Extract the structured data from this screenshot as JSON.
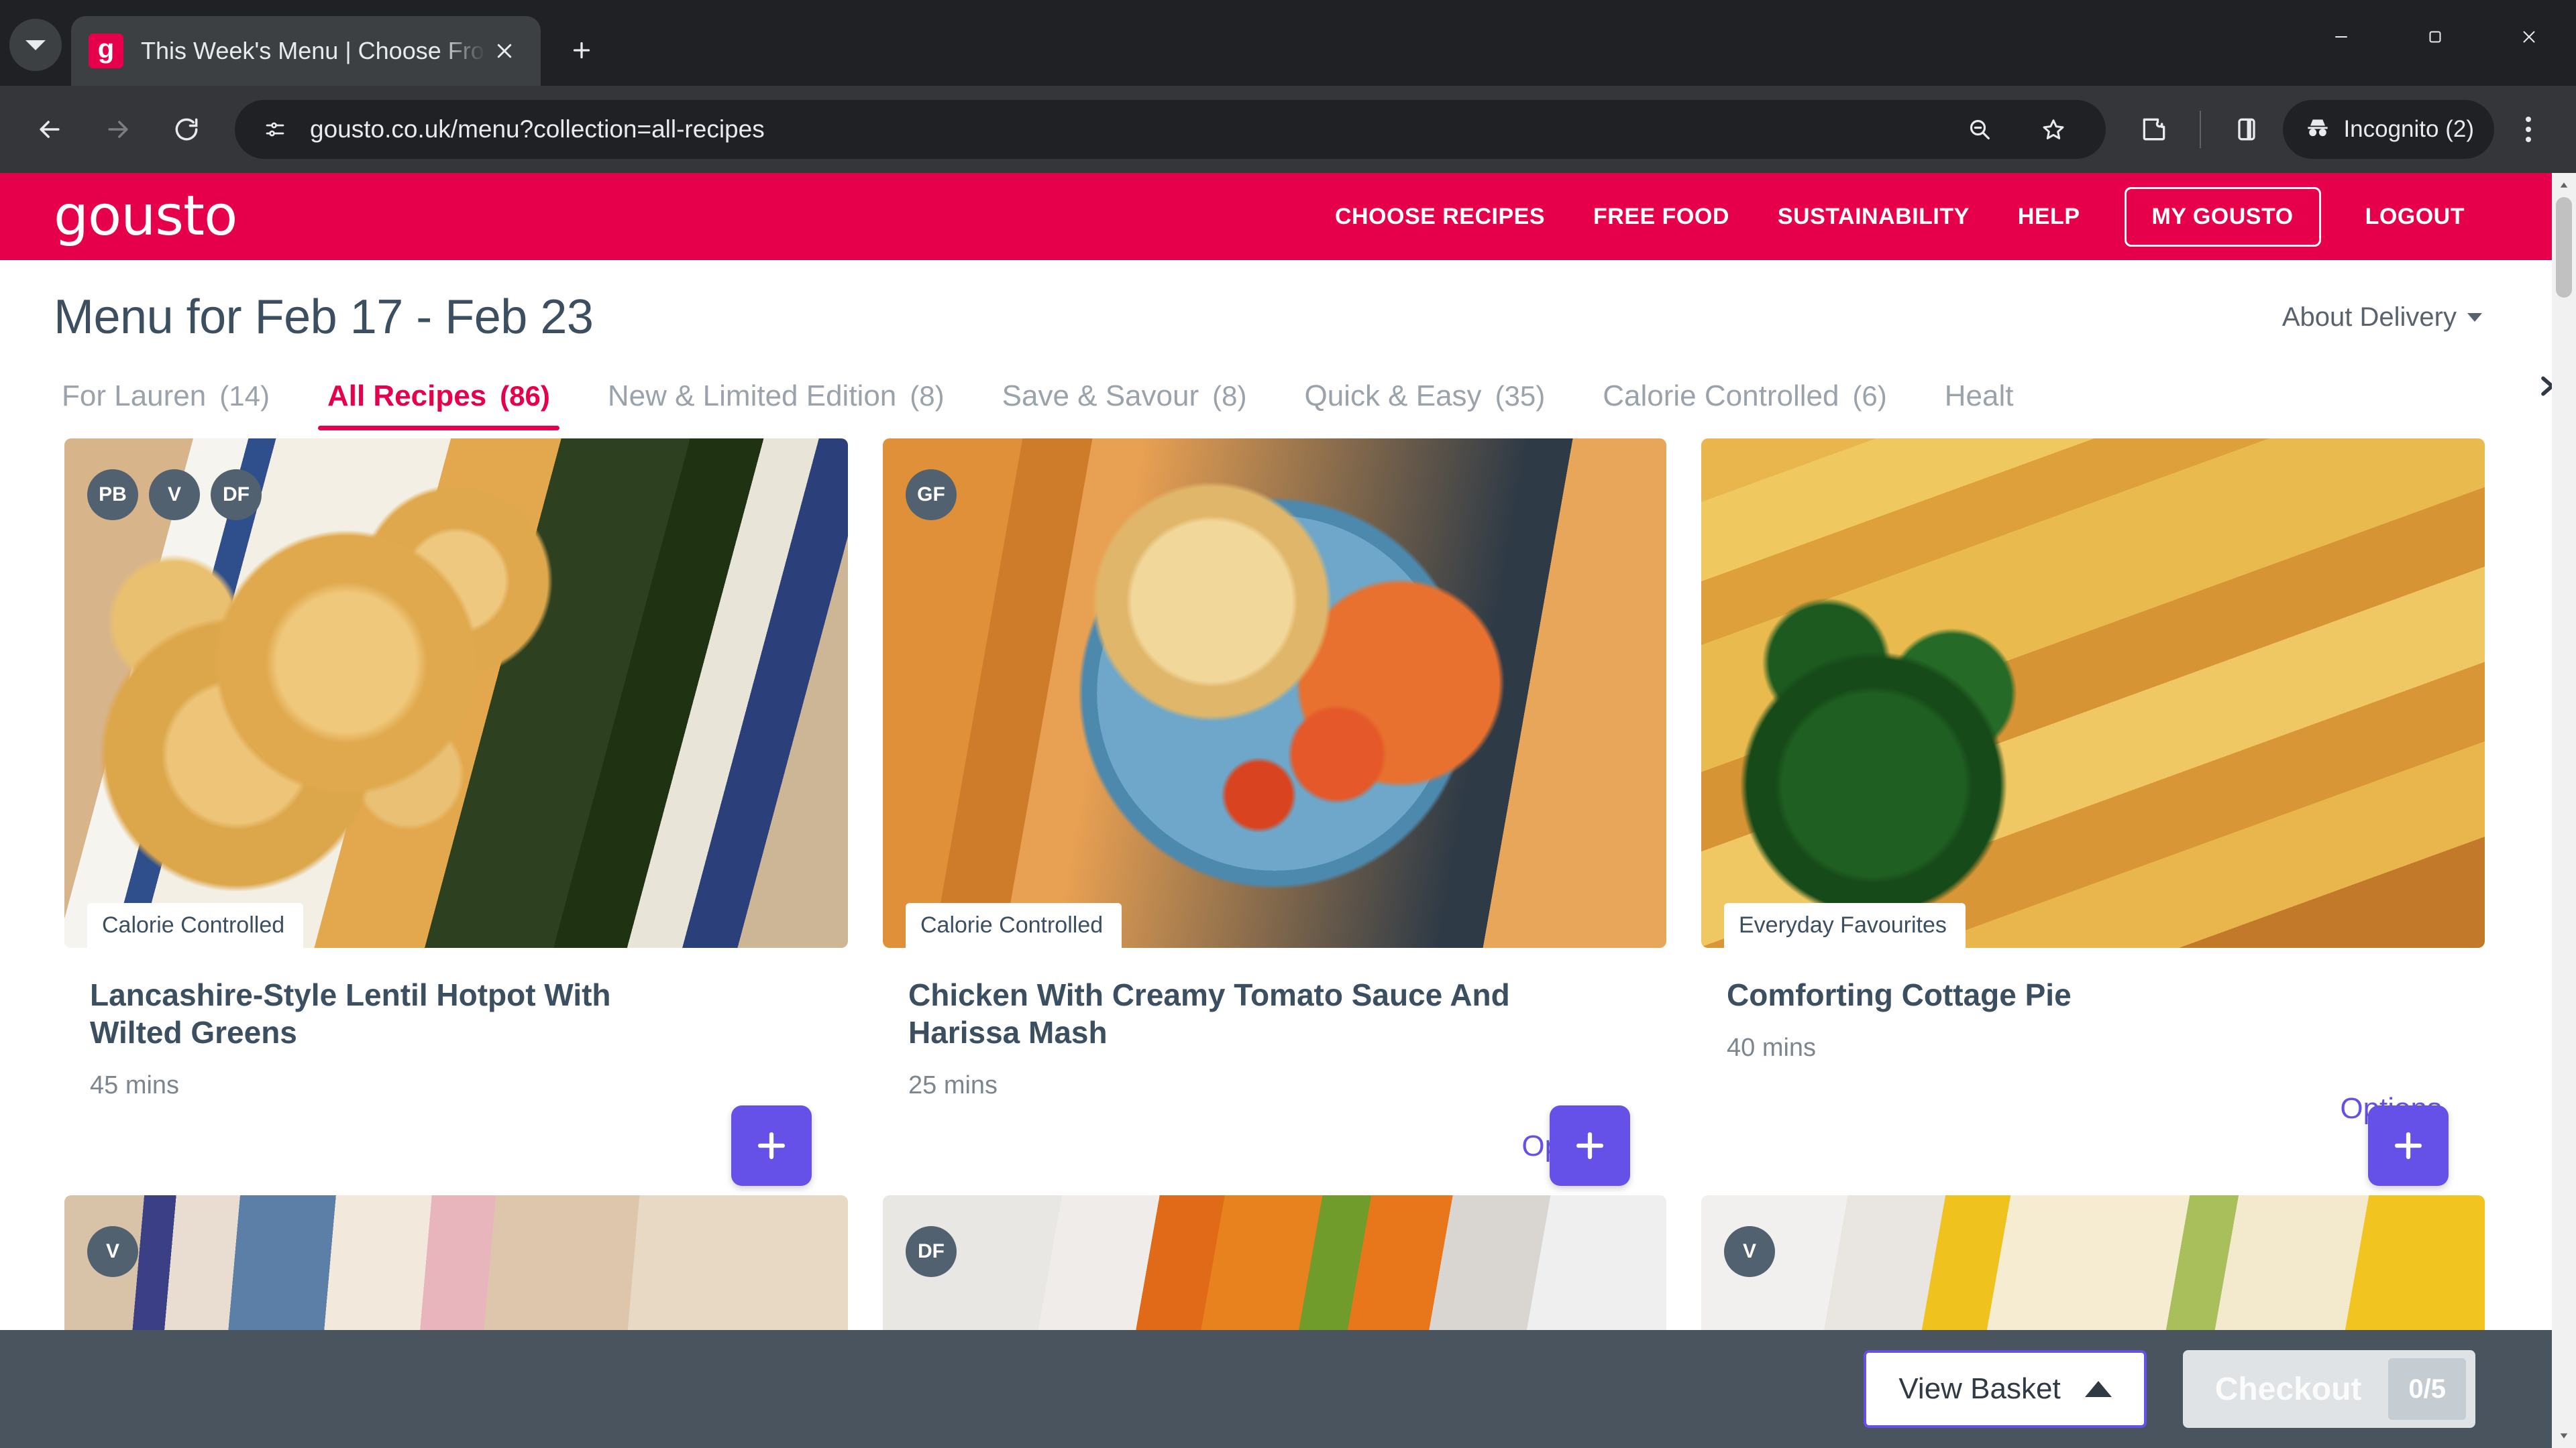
{
  "browser": {
    "tab": {
      "title": "This Week's Menu | Choose Fro",
      "favicon_letter": "g"
    },
    "new_tab_label": "+",
    "url": "gousto.co.uk/menu?collection=all-recipes",
    "profile_label": "Incognito (2)"
  },
  "site_header": {
    "logo_text": "gousto",
    "brand_color": "#E6004C",
    "nav": [
      {
        "label": "CHOOSE RECIPES",
        "boxed": false
      },
      {
        "label": "FREE FOOD",
        "boxed": false
      },
      {
        "label": "SUSTAINABILITY",
        "boxed": false
      },
      {
        "label": "HELP",
        "boxed": false
      },
      {
        "label": "MY GOUSTO",
        "boxed": true
      },
      {
        "label": "LOGOUT",
        "boxed": false
      }
    ]
  },
  "page": {
    "title": "Menu for Feb 17 - Feb 23",
    "about_delivery": "About Delivery"
  },
  "tabs": [
    {
      "label": "For Lauren",
      "count": "(14)",
      "active": false
    },
    {
      "label": "All Recipes",
      "count": "(86)",
      "active": true
    },
    {
      "label": "New & Limited Edition",
      "count": "(8)",
      "active": false
    },
    {
      "label": "Save & Savour",
      "count": "(8)",
      "active": false
    },
    {
      "label": "Quick & Easy",
      "count": "(35)",
      "active": false
    },
    {
      "label": "Calorie Controlled",
      "count": "(6)",
      "active": false
    },
    {
      "label": "Healt",
      "count": "",
      "active": false
    }
  ],
  "recipes": [
    {
      "badges": [
        "PB",
        "V",
        "DF"
      ],
      "category": "Calorie Controlled",
      "title": "Lancashire-Style Lentil Hotpot With Wilted Greens",
      "time": "45 mins",
      "add_label": "+",
      "options_label": ""
    },
    {
      "badges": [
        "GF"
      ],
      "category": "Calorie Controlled",
      "title": "Chicken With Creamy Tomato Sauce And Harissa Mash",
      "time": "25 mins",
      "add_label": "+",
      "options_label": "Options"
    },
    {
      "badges": [],
      "category": "Everyday Favourites",
      "title": "Comforting Cottage Pie",
      "time": "40 mins",
      "add_label": "+",
      "options_label": "Options"
    }
  ],
  "recipes_row2": [
    {
      "badges": [
        "V"
      ]
    },
    {
      "badges": [
        "DF"
      ]
    },
    {
      "badges": [
        "V"
      ]
    }
  ],
  "bottom_bar": {
    "view_basket_label": "View Basket",
    "checkout_label": "Checkout",
    "checkout_count": "0/5",
    "accent_color": "#6651E8"
  }
}
